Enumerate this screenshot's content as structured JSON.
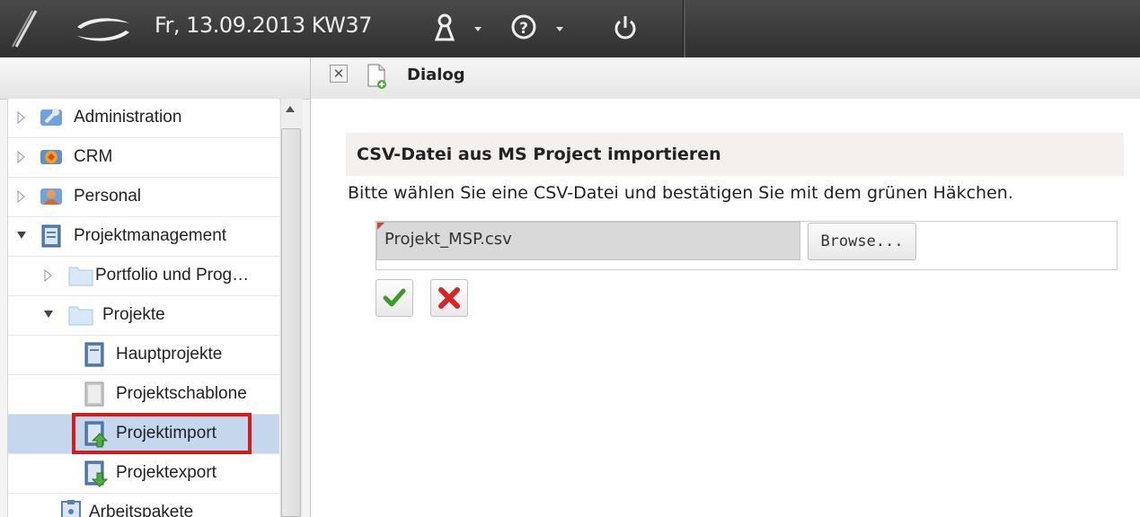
{
  "topbar": {
    "date": "Fr, 13.09.2013 KW37",
    "icons": [
      "app-logo-icon",
      "swoosh-logo-icon",
      "user-icon",
      "help-icon",
      "power-icon"
    ]
  },
  "tab": {
    "title": "Dialog",
    "close_glyph": "✕"
  },
  "tree": {
    "items": [
      {
        "label": "Administration",
        "icon": "wrench-icon"
      },
      {
        "label": "CRM",
        "icon": "crm-icon"
      },
      {
        "label": "Personal",
        "icon": "person-icon"
      },
      {
        "label": "Projektmanagement",
        "icon": "project-icon"
      },
      {
        "label": "Portfolio und Prog…",
        "icon": "folder-icon"
      },
      {
        "label": "Projekte",
        "icon": "folder-icon"
      },
      {
        "label": "Hauptprojekte",
        "icon": "document-icon"
      },
      {
        "label": "Projektschablone",
        "icon": "template-icon"
      },
      {
        "label": "Projektimport",
        "icon": "import-icon"
      },
      {
        "label": "Projektexport",
        "icon": "export-icon"
      },
      {
        "label": "Arbeitspakete",
        "icon": "clipboard-icon"
      }
    ]
  },
  "form": {
    "title": "CSV-Datei aus MS Project importieren",
    "instruction": "Bitte wählen Sie eine CSV-Datei und bestätigen Sie mit dem grünen Häkchen.",
    "file_value": "Projekt_MSP.csv",
    "browse_label": "Browse..."
  },
  "colors": {
    "topbar": "#383838",
    "selection": "#c5d7ec",
    "highlight": "#d51c1c",
    "confirm": "#3a9a2a",
    "cancel": "#d42626"
  }
}
